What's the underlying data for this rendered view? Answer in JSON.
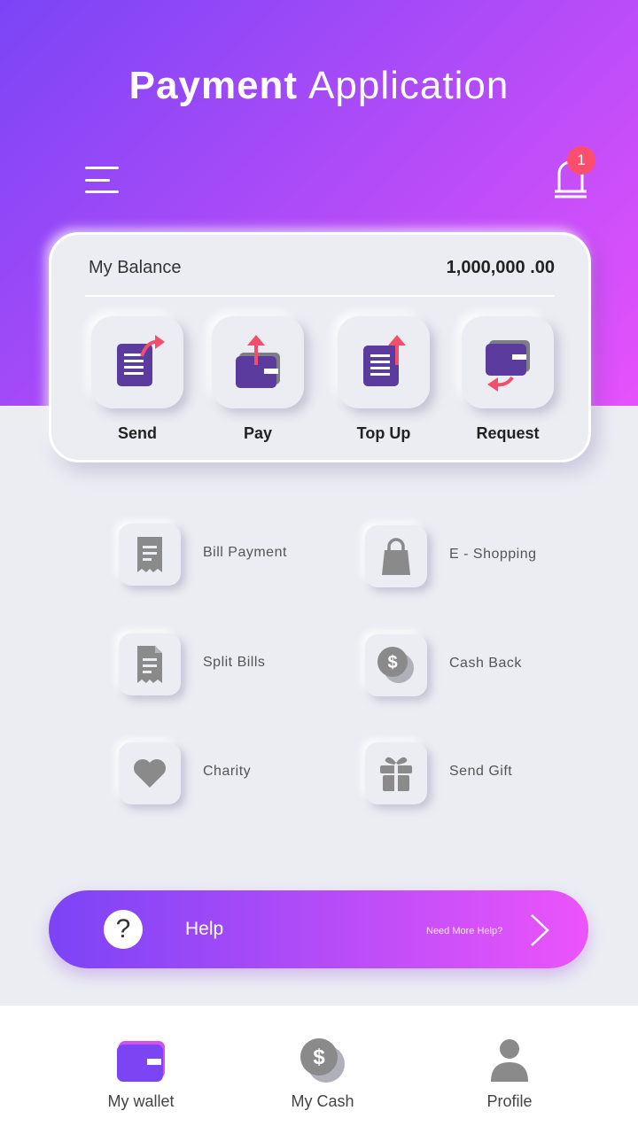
{
  "app": {
    "title_bold": "Payment",
    "title_light": "Application"
  },
  "header": {
    "notification_count": "1"
  },
  "balance": {
    "label": "My Balance",
    "value": "1,000,000 .00",
    "actions": [
      {
        "label": "Send",
        "icon": "document-send-icon"
      },
      {
        "label": "Pay",
        "icon": "wallet-pay-icon"
      },
      {
        "label": "Top Up",
        "icon": "document-topup-icon"
      },
      {
        "label": "Request",
        "icon": "wallet-request-icon"
      }
    ]
  },
  "services": [
    {
      "label": "Bill Payment",
      "icon": "receipt-icon"
    },
    {
      "label": "E - Shopping",
      "icon": "shopping-bag-icon"
    },
    {
      "label": "Split Bills",
      "icon": "split-bill-icon"
    },
    {
      "label": "Cash Back",
      "icon": "coin-icon"
    },
    {
      "label": "Charity",
      "icon": "heart-icon"
    },
    {
      "label": "Send Gift",
      "icon": "gift-icon"
    }
  ],
  "help": {
    "label": "Help",
    "subtitle": "Need More Help?",
    "icon": "question-icon"
  },
  "nav": [
    {
      "label": "My wallet",
      "icon": "wallet-icon"
    },
    {
      "label": "My Cash",
      "icon": "coin-icon"
    },
    {
      "label": "Profile",
      "icon": "user-icon"
    }
  ],
  "colors": {
    "accent_start": "#7a45f6",
    "accent_end": "#e552fb",
    "badge": "#ff4d6d",
    "icon_purple": "#5b3c9e",
    "arrow_red": "#f0506e",
    "icon_grey": "#8a8a8a"
  }
}
